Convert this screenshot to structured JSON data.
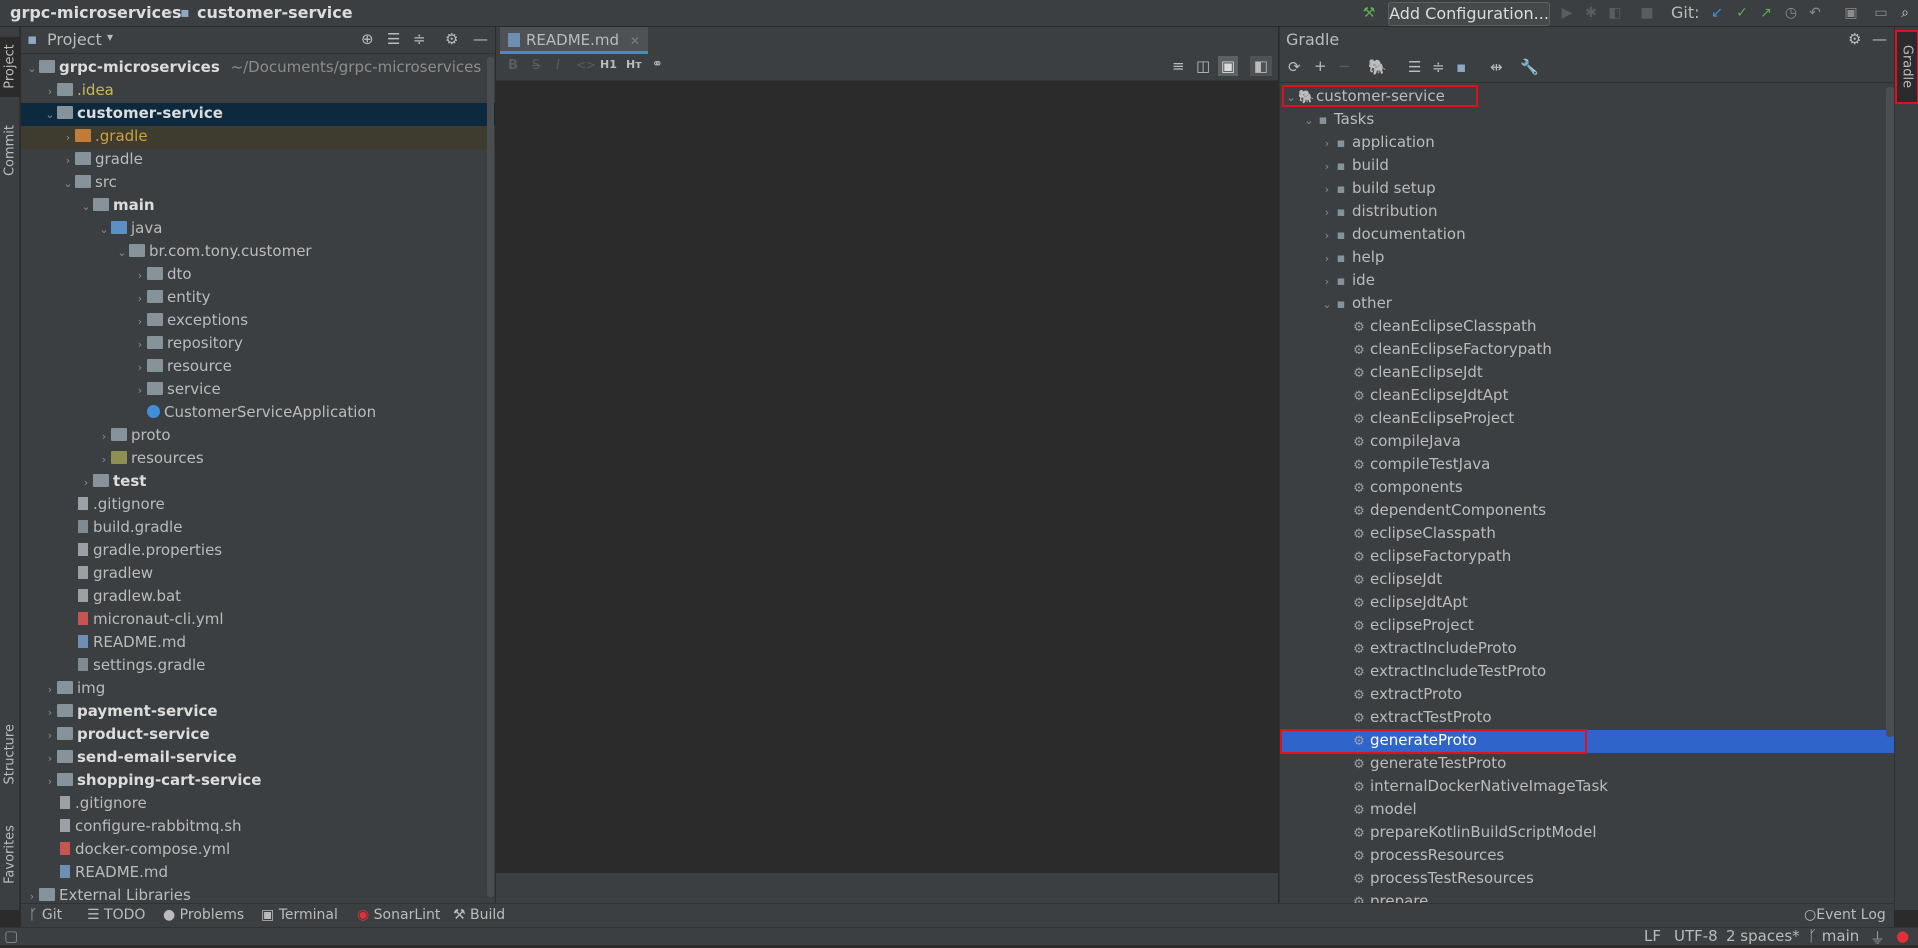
{
  "nav": {
    "project": "grpc-microservices",
    "module": "customer-service",
    "add_config": "Add Configuration...",
    "git_label": "Git:"
  },
  "left_stripe": {
    "project": "Project",
    "commit": "Commit",
    "structure": "Structure",
    "favorites": "Favorites"
  },
  "right_stripe": {
    "gradle": "Gradle"
  },
  "project_panel": {
    "title": "Project",
    "root_name": "grpc-microservices",
    "root_path": "~/Documents/grpc-microservices",
    "items": [
      {
        "label": ".idea",
        "depth": 1,
        "chev": "right",
        "icon": "folder",
        "style": "olive"
      },
      {
        "label": "customer-service",
        "depth": 1,
        "chev": "down",
        "icon": "folder-module",
        "style": "bold"
      },
      {
        "label": ".gradle",
        "depth": 2,
        "chev": "right",
        "icon": "folder-orange",
        "style": "orange"
      },
      {
        "label": "gradle",
        "depth": 2,
        "chev": "right",
        "icon": "folder",
        "style": ""
      },
      {
        "label": "src",
        "depth": 2,
        "chev": "down",
        "icon": "folder",
        "style": ""
      },
      {
        "label": "main",
        "depth": 3,
        "chev": "down",
        "icon": "folder-module",
        "style": "bold"
      },
      {
        "label": "java",
        "depth": 4,
        "chev": "down",
        "icon": "folder-blue",
        "style": ""
      },
      {
        "label": "br.com.tony.customer",
        "depth": 5,
        "chev": "down",
        "icon": "folder-package",
        "style": ""
      },
      {
        "label": "dto",
        "depth": 6,
        "chev": "right",
        "icon": "folder-package",
        "style": ""
      },
      {
        "label": "entity",
        "depth": 6,
        "chev": "right",
        "icon": "folder-package",
        "style": ""
      },
      {
        "label": "exceptions",
        "depth": 6,
        "chev": "right",
        "icon": "folder-package",
        "style": ""
      },
      {
        "label": "repository",
        "depth": 6,
        "chev": "right",
        "icon": "folder-package",
        "style": ""
      },
      {
        "label": "resource",
        "depth": 6,
        "chev": "right",
        "icon": "folder-package",
        "style": ""
      },
      {
        "label": "service",
        "depth": 6,
        "chev": "right",
        "icon": "folder-package",
        "style": ""
      },
      {
        "label": "CustomerServiceApplication",
        "depth": 6,
        "chev": "none",
        "icon": "class",
        "style": ""
      },
      {
        "label": "proto",
        "depth": 4,
        "chev": "right",
        "icon": "folder",
        "style": ""
      },
      {
        "label": "resources",
        "depth": 4,
        "chev": "right",
        "icon": "folder-resources",
        "style": ""
      },
      {
        "label": "test",
        "depth": 3,
        "chev": "right",
        "icon": "folder-module",
        "style": "bold"
      },
      {
        "label": ".gitignore",
        "depth": 2,
        "chev": "none",
        "icon": "file",
        "style": ""
      },
      {
        "label": "build.gradle",
        "depth": 2,
        "chev": "none",
        "icon": "gradle",
        "style": ""
      },
      {
        "label": "gradle.properties",
        "depth": 2,
        "chev": "none",
        "icon": "file",
        "style": ""
      },
      {
        "label": "gradlew",
        "depth": 2,
        "chev": "none",
        "icon": "file",
        "style": ""
      },
      {
        "label": "gradlew.bat",
        "depth": 2,
        "chev": "none",
        "icon": "file",
        "style": ""
      },
      {
        "label": "micronaut-cli.yml",
        "depth": 2,
        "chev": "none",
        "icon": "yml",
        "style": ""
      },
      {
        "label": "README.md",
        "depth": 2,
        "chev": "none",
        "icon": "md",
        "style": ""
      },
      {
        "label": "settings.gradle",
        "depth": 2,
        "chev": "none",
        "icon": "gradle",
        "style": ""
      },
      {
        "label": "img",
        "depth": 1,
        "chev": "right",
        "icon": "folder",
        "style": ""
      },
      {
        "label": "payment-service",
        "depth": 1,
        "chev": "right",
        "icon": "folder-module",
        "style": "bold"
      },
      {
        "label": "product-service",
        "depth": 1,
        "chev": "right",
        "icon": "folder-module",
        "style": "bold"
      },
      {
        "label": "send-email-service",
        "depth": 1,
        "chev": "right",
        "icon": "folder-module",
        "style": "bold"
      },
      {
        "label": "shopping-cart-service",
        "depth": 1,
        "chev": "right",
        "icon": "folder-module",
        "style": "bold"
      },
      {
        "label": ".gitignore",
        "depth": 1,
        "chev": "none",
        "icon": "file",
        "style": ""
      },
      {
        "label": "configure-rabbitmq.sh",
        "depth": 1,
        "chev": "none",
        "icon": "file",
        "style": ""
      },
      {
        "label": "docker-compose.yml",
        "depth": 1,
        "chev": "none",
        "icon": "yml",
        "style": ""
      },
      {
        "label": "README.md",
        "depth": 1,
        "chev": "none",
        "icon": "md",
        "style": ""
      },
      {
        "label": "External Libraries",
        "depth": 0,
        "chev": "right",
        "icon": "lib",
        "style": ""
      }
    ]
  },
  "editor": {
    "tab_label": "README.md",
    "toolbar": {
      "bold": "B",
      "strike": "S",
      "italic": "I",
      "code": "<>",
      "h1": "H1",
      "ht": "Hт"
    }
  },
  "gradle_panel": {
    "title": "Gradle",
    "root": "customer-service",
    "tasks_label": "Tasks",
    "groups": [
      "application",
      "build",
      "build setup",
      "distribution",
      "documentation",
      "help",
      "ide"
    ],
    "open_group": "other",
    "tasks": [
      "cleanEclipseClasspath",
      "cleanEclipseFactorypath",
      "cleanEclipseJdt",
      "cleanEclipseJdtApt",
      "cleanEclipseProject",
      "compileJava",
      "compileTestJava",
      "components",
      "dependentComponents",
      "eclipseClasspath",
      "eclipseFactorypath",
      "eclipseJdt",
      "eclipseJdtApt",
      "eclipseProject",
      "extractIncludeProto",
      "extractIncludeTestProto",
      "extractProto",
      "extractTestProto",
      "generateProto",
      "generateTestProto",
      "internalDockerNativeImageTask",
      "model",
      "prepareKotlinBuildScriptModel",
      "processResources",
      "processTestResources",
      "prepare"
    ],
    "selected_task": "generateProto"
  },
  "bottom_tools": [
    "Git",
    "TODO",
    "Problems",
    "Terminal",
    "SonarLint",
    "Build"
  ],
  "event_log": "Event Log",
  "status": {
    "line_sep": "LF",
    "encoding": "UTF-8",
    "indent": "2 spaces*",
    "branch": "main"
  },
  "colors": {
    "accent": "#2f65ca",
    "highlight": "#e0101c",
    "selection": "#0d293e"
  }
}
